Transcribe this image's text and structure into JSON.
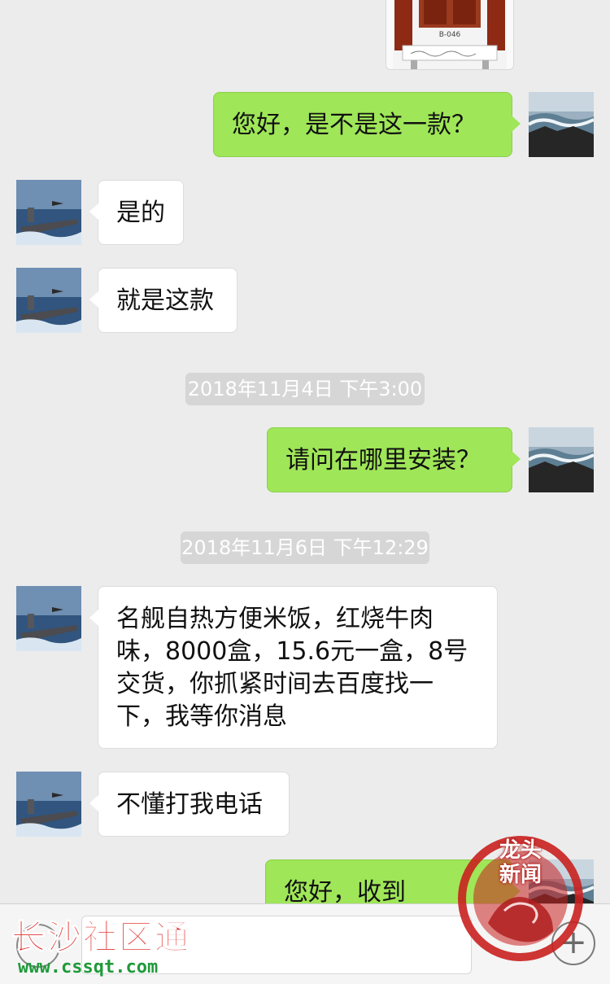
{
  "messages": [
    {
      "side": "out",
      "text": "您好，是不是这一款？"
    },
    {
      "side": "in",
      "text": "是的"
    },
    {
      "side": "in",
      "text": "就是这款"
    },
    {
      "side": "out",
      "text": "请问在哪里安装？"
    },
    {
      "side": "in",
      "lines": [
        "名舰自热方便米饭，红烧牛肉",
        "味，8000盒，15.6元一盒，8号",
        "交货，你抓紧时间去百度找一",
        "下，我等你消息"
      ]
    },
    {
      "side": "in",
      "text": "不懂打我电话"
    },
    {
      "side": "out",
      "text": "您好，收到"
    }
  ],
  "timestamps": [
    "2018年11月4日 下午3:00",
    "2018年11月6日 下午12:29"
  ],
  "image_message": {
    "label": "B-046"
  },
  "watermarks": {
    "site_name": "长沙社区通",
    "site_url": "www.cssqt.com",
    "seal_lines": [
      "龙头",
      "新闻"
    ]
  },
  "input_bar": {
    "add_icon": "plus-icon",
    "voice_icon": "voice-icon"
  },
  "colors": {
    "outgoing_bubble": "#9fe658",
    "incoming_bubble": "#ffffff",
    "background": "#ececec",
    "watermark_red": "#e02a2a",
    "watermark_green": "#1f9a3a"
  }
}
